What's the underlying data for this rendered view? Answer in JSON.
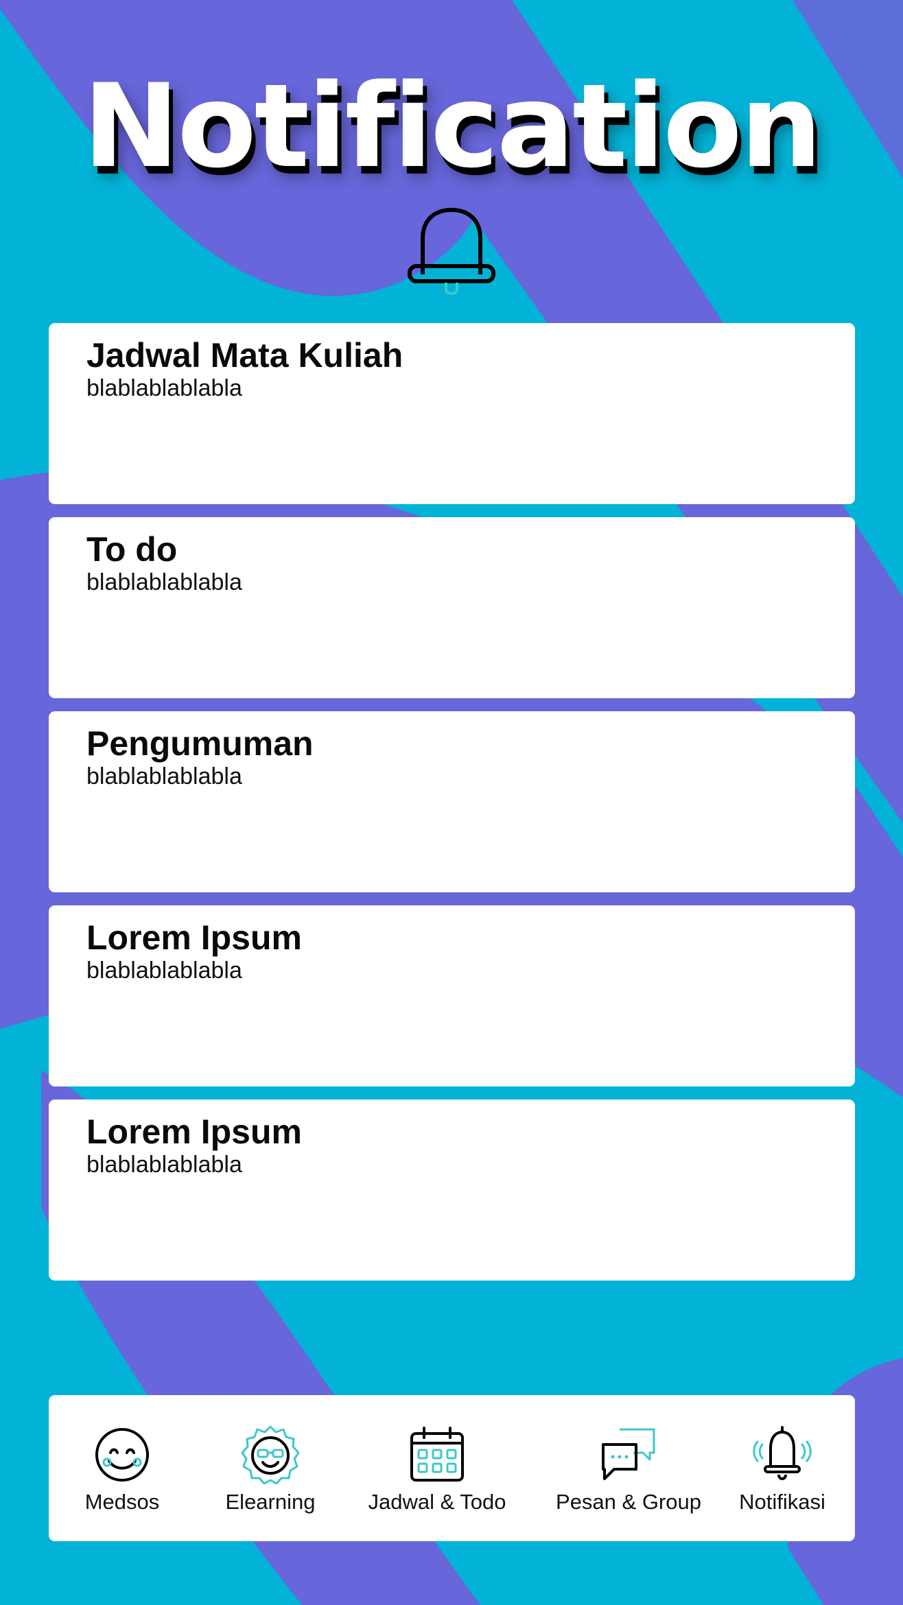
{
  "header": {
    "title": "Notification"
  },
  "notifications": [
    {
      "title": "Jadwal Mata Kuliah",
      "body": "blablablablabla"
    },
    {
      "title": "To do",
      "body": "blablablablabla"
    },
    {
      "title": "Pengumuman",
      "body": "blablablablabla"
    },
    {
      "title": "Lorem Ipsum",
      "body": "blablablablabla"
    },
    {
      "title": "Lorem Ipsum",
      "body": "blablablablabla"
    }
  ],
  "bottom_nav": {
    "items": [
      {
        "label": "Medsos",
        "icon": "smiley-face-icon"
      },
      {
        "label": "Elearning",
        "icon": "cool-face-badge-icon"
      },
      {
        "label": "Jadwal & Todo",
        "icon": "calendar-icon"
      },
      {
        "label": "Pesan & Group",
        "icon": "chat-bubbles-icon"
      },
      {
        "label": "Notifikasi",
        "icon": "ringing-bell-icon",
        "active": true
      }
    ]
  },
  "colors": {
    "background": "#03b3d7",
    "swoosh": "#6766da",
    "accent": "#3cc8c8",
    "card": "#ffffff"
  }
}
